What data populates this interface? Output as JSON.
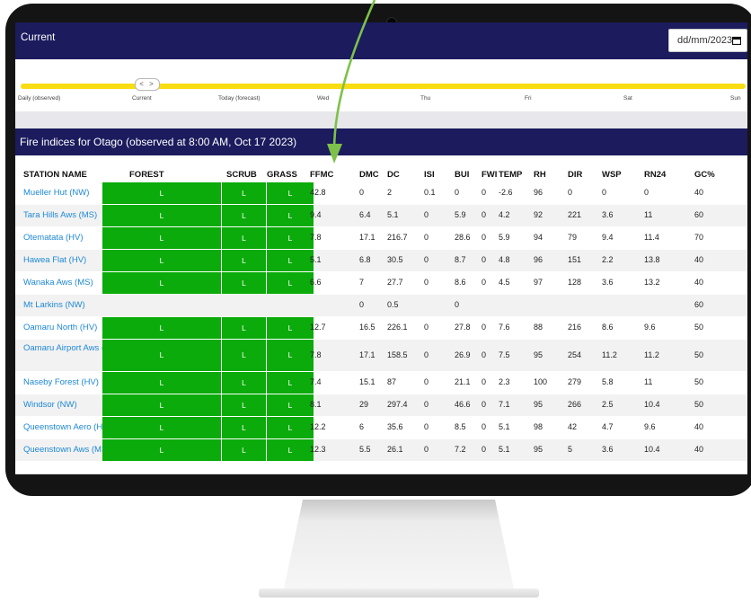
{
  "header": {
    "title": "Current"
  },
  "date_input": {
    "value": "dd/mm/2023"
  },
  "timeline": {
    "handle_label": "< >",
    "labels": [
      "Daily (observed)",
      "Current",
      "Today (forecast)",
      "Wed",
      "Thu",
      "Fri",
      "Sat",
      "Sun"
    ]
  },
  "panel": {
    "title": "Fire indices for Otago (observed at 8:00 AM, Oct 17 2023)"
  },
  "columns": [
    "STATION NAME",
    "FOREST",
    "SCRUB",
    "GRASS",
    "FFMC",
    "DMC",
    "DC",
    "ISI",
    "BUI",
    "FWI",
    "TEMP",
    "RH",
    "DIR",
    "WSP",
    "RN24",
    "GC%"
  ],
  "rows": [
    {
      "station": "Mueller Hut (NW)",
      "forest": "L",
      "scrub": "L",
      "grass": "L",
      "ffmc": "42.8",
      "dmc": "0",
      "dc": "2",
      "isi": "0.1",
      "bui": "0",
      "fwi": "0",
      "temp": "-2.6",
      "rh": "96",
      "dir": "0",
      "wsp": "0",
      "rn24": "0",
      "gc": "40"
    },
    {
      "station": "Tara Hills Aws (MS)",
      "forest": "L",
      "scrub": "L",
      "grass": "L",
      "ffmc": "9.4",
      "dmc": "6.4",
      "dc": "5.1",
      "isi": "0",
      "bui": "5.9",
      "fwi": "0",
      "temp": "4.2",
      "rh": "92",
      "dir": "221",
      "wsp": "3.6",
      "rn24": "11",
      "gc": "60"
    },
    {
      "station": "Otematata (HV)",
      "forest": "L",
      "scrub": "L",
      "grass": "L",
      "ffmc": "7.8",
      "dmc": "17.1",
      "dc": "216.7",
      "isi": "0",
      "bui": "28.6",
      "fwi": "0",
      "temp": "5.9",
      "rh": "94",
      "dir": "79",
      "wsp": "9.4",
      "rn24": "11.4",
      "gc": "70"
    },
    {
      "station": "Hawea Flat (HV)",
      "forest": "L",
      "scrub": "L",
      "grass": "L",
      "ffmc": "5.1",
      "dmc": "6.8",
      "dc": "30.5",
      "isi": "0",
      "bui": "8.7",
      "fwi": "0",
      "temp": "4.8",
      "rh": "96",
      "dir": "151",
      "wsp": "2.2",
      "rn24": "13.8",
      "gc": "40"
    },
    {
      "station": "Wanaka Aws (MS)",
      "forest": "L",
      "scrub": "L",
      "grass": "L",
      "ffmc": "6.6",
      "dmc": "7",
      "dc": "27.7",
      "isi": "0",
      "bui": "8.6",
      "fwi": "0",
      "temp": "4.5",
      "rh": "97",
      "dir": "128",
      "wsp": "3.6",
      "rn24": "13.2",
      "gc": "40"
    },
    {
      "station": "Mt Larkins (NW)",
      "forest": "",
      "scrub": "",
      "grass": "",
      "ffmc": "",
      "dmc": "0",
      "dc": "0.5",
      "isi": "",
      "bui": "0",
      "fwi": "",
      "temp": "",
      "rh": "",
      "dir": "",
      "wsp": "",
      "rn24": "",
      "gc": "60"
    },
    {
      "station": "Oamaru North (HV)",
      "forest": "L",
      "scrub": "L",
      "grass": "L",
      "ffmc": "12.7",
      "dmc": "16.5",
      "dc": "226.1",
      "isi": "0",
      "bui": "27.8",
      "fwi": "0",
      "temp": "7.6",
      "rh": "88",
      "dir": "216",
      "wsp": "8.6",
      "rn24": "9.6",
      "gc": "50"
    },
    {
      "station": "Oamaru Airport Aws (MS)",
      "forest": "L",
      "scrub": "L",
      "grass": "L",
      "ffmc": "7.8",
      "dmc": "17.1",
      "dc": "158.5",
      "isi": "0",
      "bui": "26.9",
      "fwi": "0",
      "temp": "7.5",
      "rh": "95",
      "dir": "254",
      "wsp": "11.2",
      "rn24": "11.2",
      "gc": "50"
    },
    {
      "station": "Naseby Forest (HV)",
      "forest": "L",
      "scrub": "L",
      "grass": "L",
      "ffmc": "7.4",
      "dmc": "15.1",
      "dc": "87",
      "isi": "0",
      "bui": "21.1",
      "fwi": "0",
      "temp": "2.3",
      "rh": "100",
      "dir": "279",
      "wsp": "5.8",
      "rn24": "11",
      "gc": "50"
    },
    {
      "station": "Windsor (NW)",
      "forest": "L",
      "scrub": "L",
      "grass": "L",
      "ffmc": "8.1",
      "dmc": "29",
      "dc": "297.4",
      "isi": "0",
      "bui": "46.6",
      "fwi": "0",
      "temp": "7.1",
      "rh": "95",
      "dir": "266",
      "wsp": "2.5",
      "rn24": "10.4",
      "gc": "50"
    },
    {
      "station": "Queenstown Aero (HV)",
      "forest": "L",
      "scrub": "L",
      "grass": "L",
      "ffmc": "12.2",
      "dmc": "6",
      "dc": "35.6",
      "isi": "0",
      "bui": "8.5",
      "fwi": "0",
      "temp": "5.1",
      "rh": "98",
      "dir": "42",
      "wsp": "4.7",
      "rn24": "9.6",
      "gc": "40"
    },
    {
      "station": "Queenstown Aws (MS)",
      "forest": "L",
      "scrub": "L",
      "grass": "L",
      "ffmc": "12.3",
      "dmc": "5.5",
      "dc": "26.1",
      "isi": "0",
      "bui": "7.2",
      "fwi": "0",
      "temp": "5.1",
      "rh": "95",
      "dir": "5",
      "wsp": "3.6",
      "rn24": "10.4",
      "gc": "40"
    }
  ],
  "colors": {
    "navy": "#1b1b5e",
    "rating_green": "#0aab0a",
    "slider_yellow": "#f8dd12",
    "link_blue": "#1e88d6",
    "arrow_green": "#7dc14a"
  }
}
